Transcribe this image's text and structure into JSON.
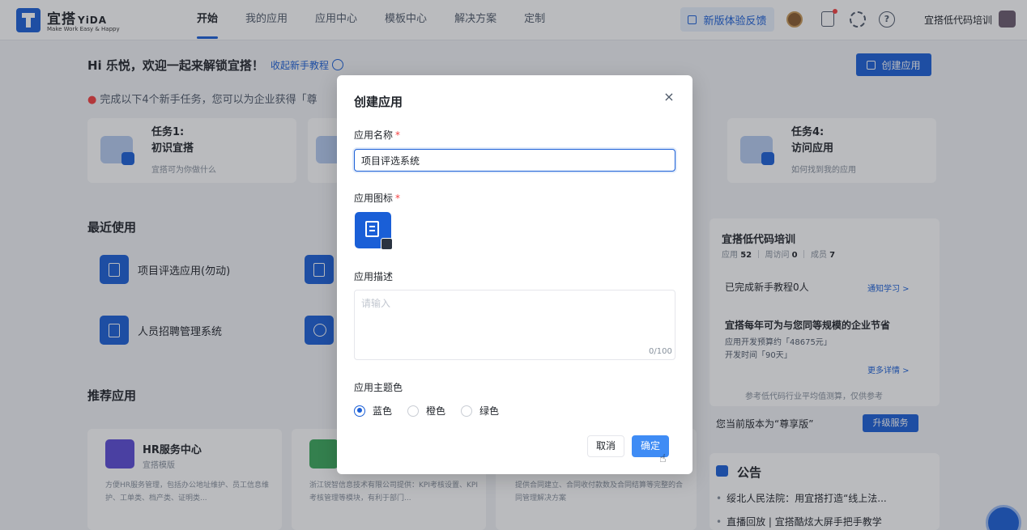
{
  "topbar": {
    "logo_name": "宜搭",
    "logo_en": "YiDA",
    "logo_tagline": "Make Work Easy & Happy",
    "nav": [
      "开始",
      "我的应用",
      "应用中心",
      "模板中心",
      "解决方案",
      "定制"
    ],
    "feedback_label": "新版体验反馈",
    "org_name": "宜搭低代码培训",
    "icons": [
      "coin-icon",
      "todo-icon",
      "gear-icon",
      "help-icon"
    ],
    "help_glyph": "?"
  },
  "home": {
    "welcome": "Hi 乐悦，欢迎一起来解锁宜搭！",
    "collapse_link": "收起新手教程",
    "create_app_label": "创建应用",
    "tasks_tip": "完成以下4个新手任务，您可以为企业获得「尊",
    "tasks": [
      {
        "title": "任务1:",
        "name": "初识宜搭",
        "sub": "宜搭可为你做什么"
      },
      {
        "title": "任务4:",
        "name": "访问应用",
        "sub": "如何找到我的应用"
      }
    ],
    "recent_title": "最近使用",
    "recent_apps": [
      "项目评选应用(勿动)",
      "人员招聘管理系统"
    ],
    "recommend_title": "推荐应用",
    "recommend_cards": [
      {
        "title": "HR服务中心",
        "tag": "宜搭模版",
        "desc": "方便HR服务管理，包括办公地址维护、员工信息维护、工单类、档产类、证明类..."
      },
      {
        "title": "",
        "tag": "",
        "desc": "浙江锐智信息技术有限公司提供：KPI考核设置、KPI考核管理等模块，有利于部门..."
      },
      {
        "title": "",
        "tag": "",
        "desc": "提供合同建立、合同收付款数及合同结算等完整的合同管理解决方案"
      }
    ]
  },
  "right_panel": {
    "org_title": "宜搭低代码培训",
    "stats": {
      "apps_label": "应用",
      "apps": "52",
      "visits_label": "周访问",
      "visits": "0",
      "members_label": "成员",
      "members": "7"
    },
    "tutorial_done": "已完成新手教程0人",
    "notify_link": "通知学习 >",
    "saving_title": "宜搭每年可为与您同等规模的企业节省",
    "saving_cost": "应用开发预算约「48675元」",
    "saving_time": "开发时间「90天」",
    "more_link": "更多详情 >",
    "saving_footnote": "参考低代码行业平均值测算，仅供参考",
    "version_text": "您当前版本为“尊享版”",
    "upgrade_label": "升级服务",
    "notice_title": "公告",
    "notices": [
      "绥北人民法院：用宜搭打造“线上法...",
      "直播回放 | 宜搭酷炫大屏手把手教学"
    ]
  },
  "modal": {
    "title": "创建应用",
    "close_glyph": "×",
    "name_label": "应用名称",
    "required_mark": "*",
    "name_value": "项目评选系统",
    "icon_label": "应用图标",
    "desc_label": "应用描述",
    "desc_placeholder": "请输入",
    "desc_count": "0/100",
    "theme_label": "应用主题色",
    "theme_options": [
      "蓝色",
      "橙色",
      "绿色"
    ],
    "theme_selected": "蓝色",
    "cancel_label": "取消",
    "ok_label": "确定"
  },
  "colors": {
    "primary": "#1a5fd7",
    "ok_button": "#3f8cf5",
    "required": "#f53f3f",
    "hr_icon": "#5b4bd6",
    "kpi_icon": "#3aa85a"
  }
}
